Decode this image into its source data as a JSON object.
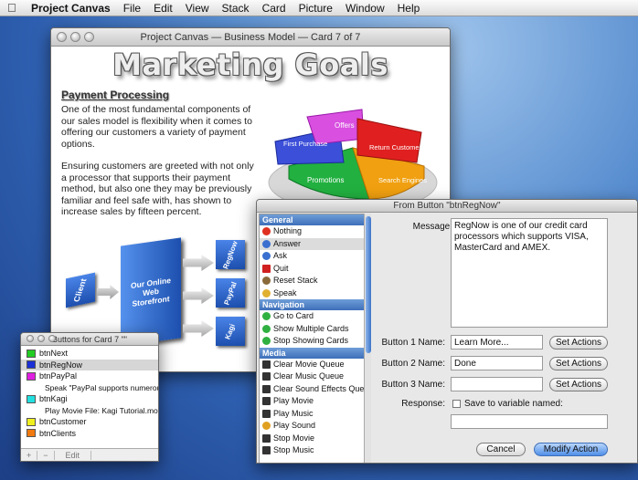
{
  "menubar": {
    "app": "Project Canvas",
    "items": [
      "File",
      "Edit",
      "View",
      "Stack",
      "Card",
      "Picture",
      "Window",
      "Help"
    ]
  },
  "main_window": {
    "title": "Project Canvas — Business Model — Card 7 of 7",
    "slide_title": "Marketing Goals",
    "subhead": "Payment Processing",
    "para1": "One of the most fundamental components of our sales model is flexibility when it comes to offering our customers a variety of payment options.",
    "para2": "Ensuring customers are greeted with not only a processor that supports their payment method, but also one they may be previously familiar and feel safe with, has shown to increase sales by fifteen percent.",
    "pie_labels": [
      "Offers",
      "First Purchase",
      "Return Customers",
      "Promotions",
      "Search Engines"
    ],
    "flow": {
      "client": "Client",
      "storefront": "Our Online Web Storefront",
      "processors": [
        "RegNow",
        "PayPal",
        "Kagi"
      ]
    }
  },
  "dialog": {
    "title": "From Button \"btnRegNow\"",
    "sections": [
      {
        "name": "General",
        "items": [
          "Nothing",
          "Answer",
          "Ask",
          "Quit",
          "Reset Stack",
          "Speak"
        ]
      },
      {
        "name": "Navigation",
        "items": [
          "Go to Card",
          "Show Multiple Cards",
          "Stop Showing Cards"
        ]
      },
      {
        "name": "Media",
        "items": [
          "Clear Movie Queue",
          "Clear Music Queue",
          "Clear Sound Effects Queue",
          "Play Movie",
          "Play Music",
          "Play Sound",
          "Stop Movie",
          "Stop Music"
        ]
      }
    ],
    "selected_item": "Answer",
    "message_label": "Message:",
    "message_value": "RegNow is one of our credit card processors which supports VISA, MasterCard and AMEX.",
    "button1_label": "Button 1 Name:",
    "button1_value": "Learn More...",
    "button2_label": "Button 2 Name:",
    "button2_value": "Done",
    "button3_label": "Button 3 Name:",
    "button3_value": "",
    "set_actions": "Set Actions",
    "response_label": "Response:",
    "save_var_label": "Save to variable named:",
    "cancel": "Cancel",
    "modify": "Modify Action"
  },
  "list_window": {
    "title": "Buttons for Card 7 \"\"",
    "rows": [
      {
        "name": "btnNext",
        "color": "#22cc22"
      },
      {
        "name": "btnRegNow",
        "color": "#1a2fd6",
        "selected": true
      },
      {
        "name": "btnPayPal",
        "color": "#e020e0"
      },
      {
        "sub": "Speak \"PayPal supports numerous payme..."
      },
      {
        "name": "btnKagi",
        "color": "#22e0e0"
      },
      {
        "sub": "Play Movie File: Kagi Tutorial.mov"
      },
      {
        "name": "btnCustomer",
        "color": "#f0f020"
      },
      {
        "name": "btnClients",
        "color": "#f07a10"
      }
    ],
    "bottom": [
      "+",
      "−",
      "Edit"
    ]
  }
}
